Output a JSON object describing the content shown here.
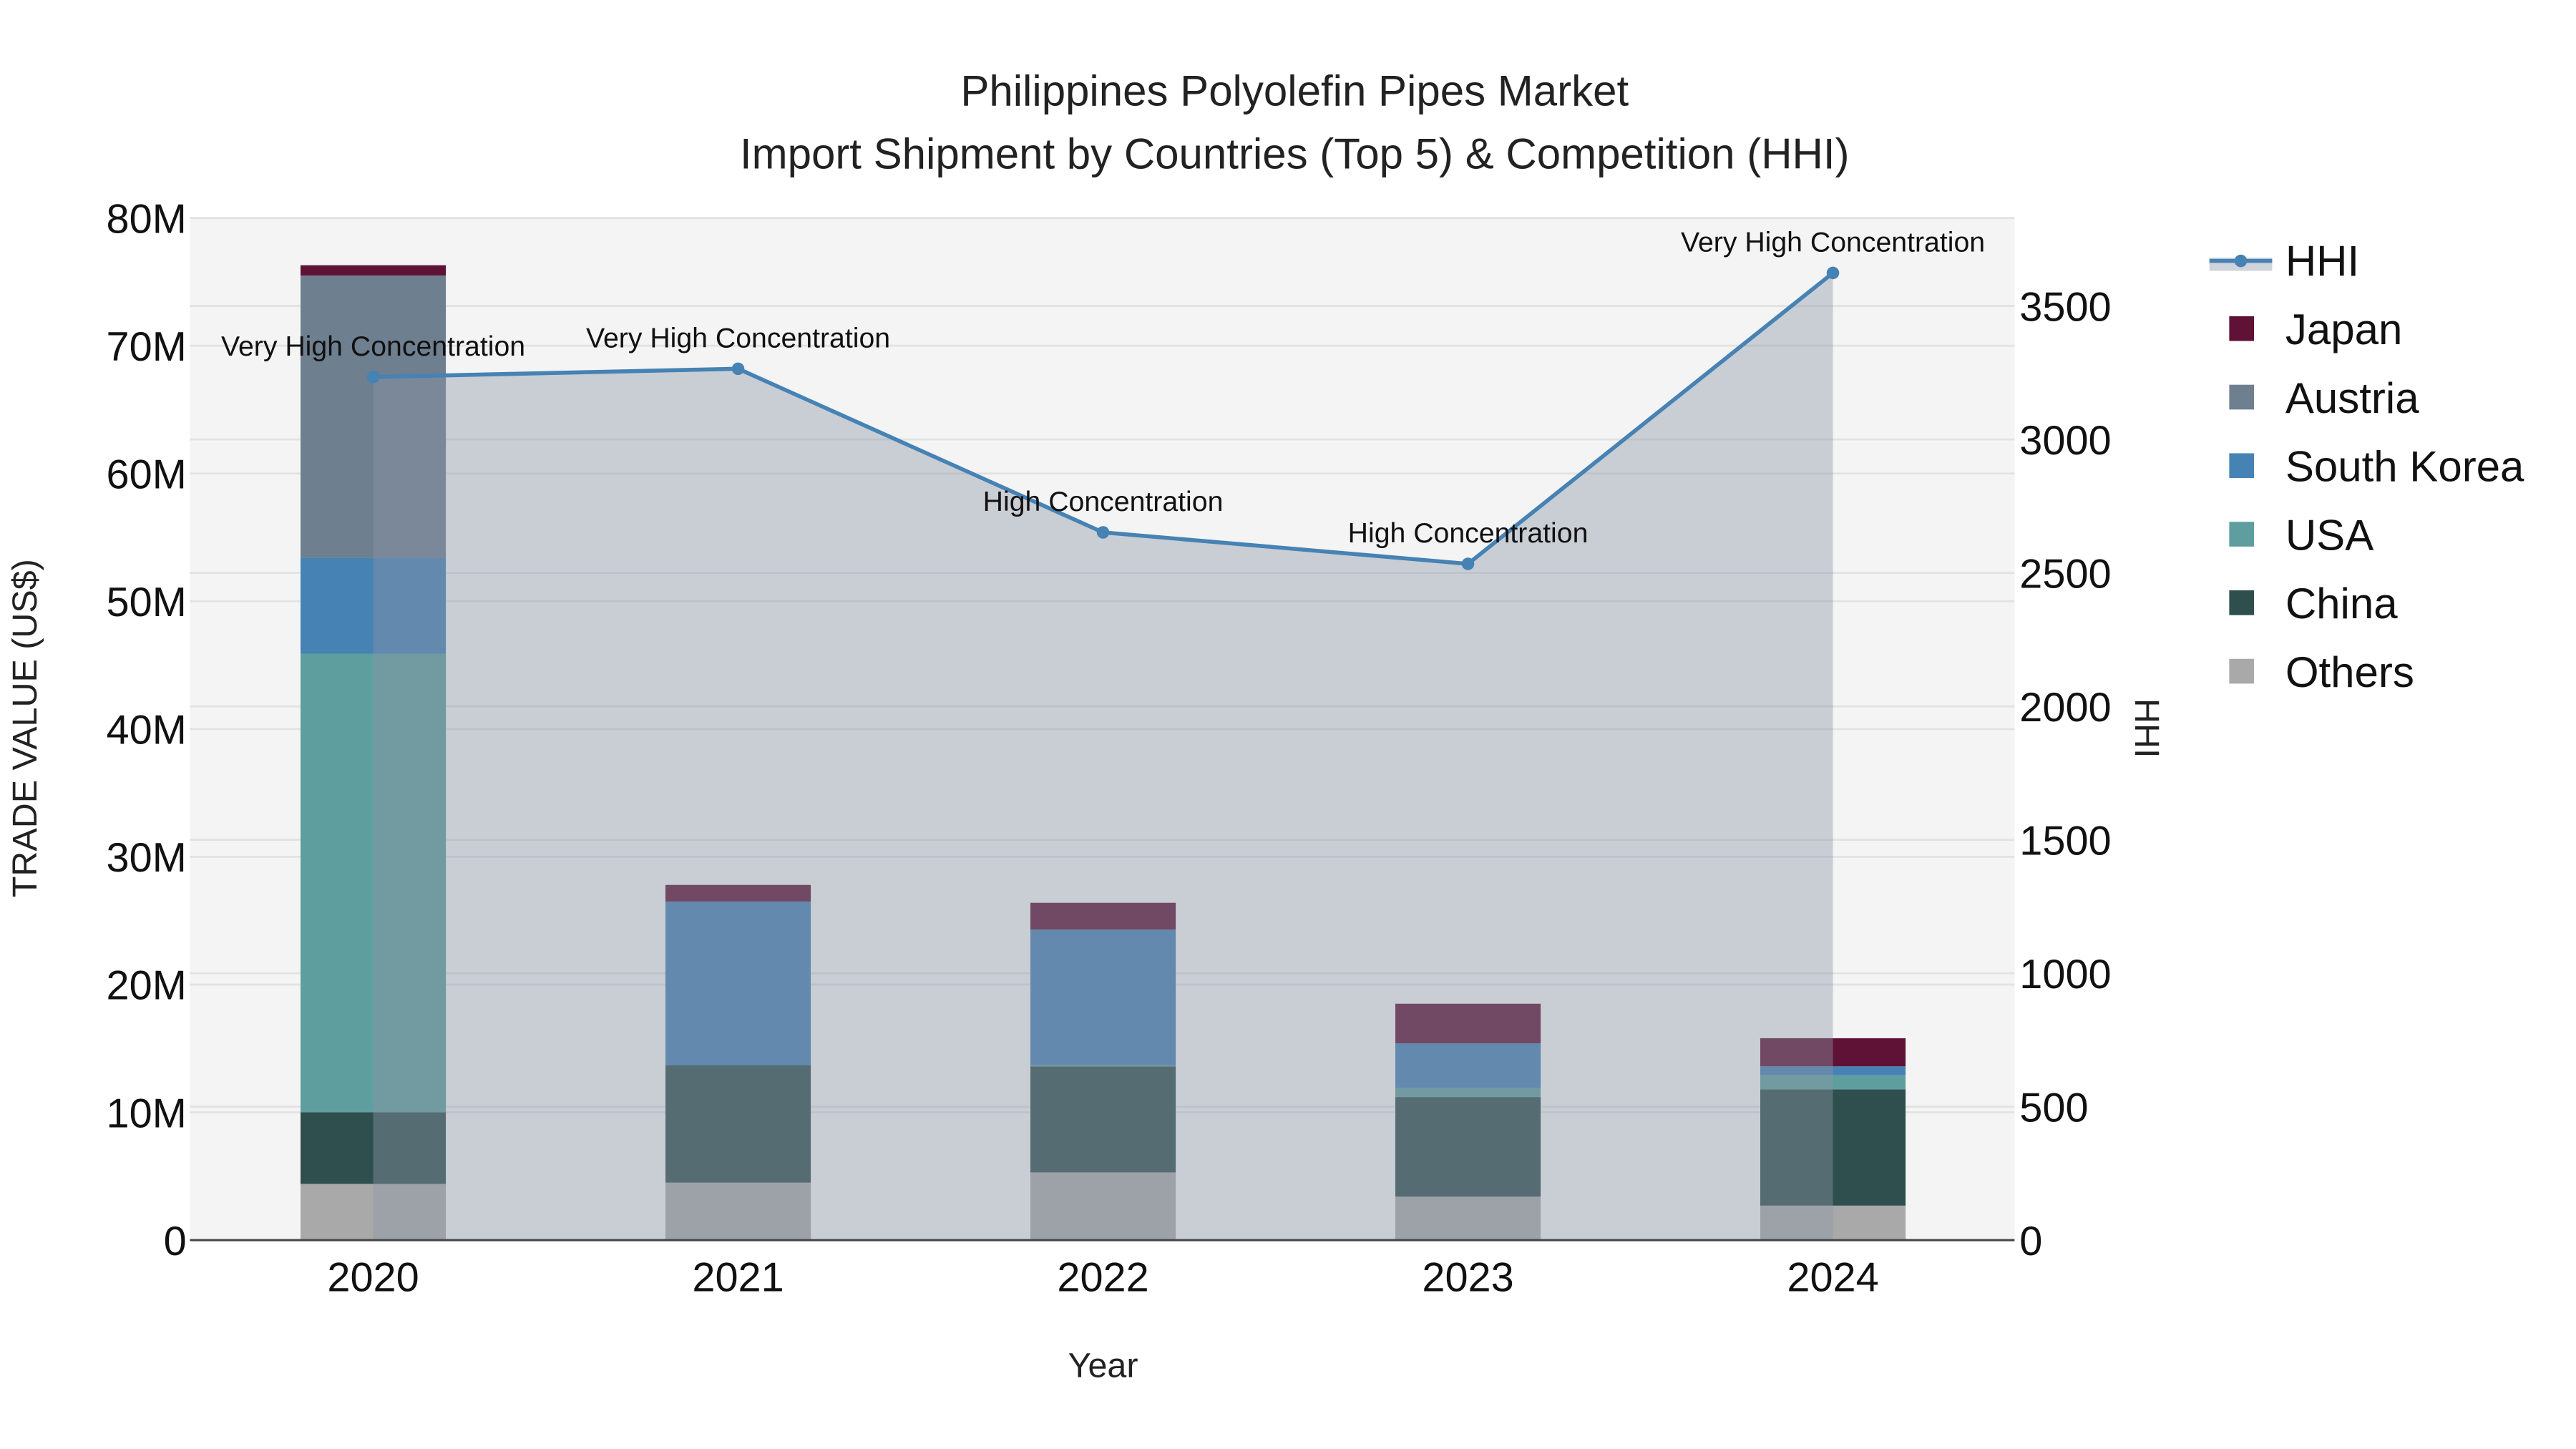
{
  "chart_data": {
    "type": "bar",
    "title": "Philippines Polyolefin Pipes Market",
    "subtitle": "Import Shipment by Countries (Top 5) & Competition (HHI)",
    "xlabel": "Year",
    "ylabel": "TRADE VALUE (US$)",
    "y2label": "HHI",
    "categories": [
      "2020",
      "2021",
      "2022",
      "2023",
      "2024"
    ],
    "ylim": [
      0,
      80000000
    ],
    "y_ticks": [
      "0",
      "10M",
      "20M",
      "30M",
      "40M",
      "50M",
      "60M",
      "70M",
      "80M"
    ],
    "y2lim": [
      0,
      3830
    ],
    "y2_ticks": [
      "0",
      "500",
      "1000",
      "1500",
      "2000",
      "2500",
      "3000",
      "3500"
    ],
    "grid": true,
    "legend_position": "right",
    "series": [
      {
        "name": "Others",
        "color": "#a9a9a9",
        "values": [
          4400000,
          4500000,
          5300000,
          3400000,
          2700000
        ]
      },
      {
        "name": "China",
        "color": "#2f4f4f",
        "values": [
          5600000,
          9200000,
          8300000,
          7800000,
          9100000
        ]
      },
      {
        "name": "USA",
        "color": "#5f9e9e",
        "values": [
          35900000,
          0,
          100000,
          700000,
          1100000
        ]
      },
      {
        "name": "South Korea",
        "color": "#4682b4",
        "values": [
          7500000,
          12800000,
          10600000,
          3500000,
          700000
        ]
      },
      {
        "name": "Austria",
        "color": "#6e7f8f",
        "values": [
          22100000,
          0,
          0,
          0,
          0
        ]
      },
      {
        "name": "Japan",
        "color": "#5f1236",
        "values": [
          800000,
          1300000,
          2100000,
          3100000,
          2200000
        ]
      }
    ],
    "hhi": {
      "name": "HHI",
      "color": "#4682b4",
      "values": [
        3234,
        3265,
        2652,
        2534,
        3624
      ],
      "labels": [
        "Very High Concentration",
        "Very High Concentration",
        "High Concentration",
        "High Concentration",
        "Very High Concentration"
      ]
    },
    "legend": [
      "HHI",
      "Japan",
      "Austria",
      "South Korea",
      "USA",
      "China",
      "Others"
    ]
  }
}
